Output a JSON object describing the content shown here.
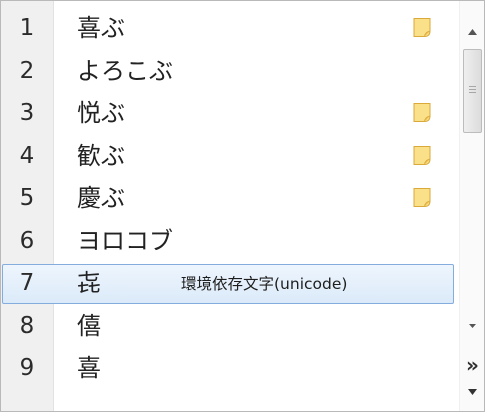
{
  "candidates": [
    {
      "num": "1",
      "word": "喜ぶ",
      "memo": true
    },
    {
      "num": "2",
      "word": "よろこぶ",
      "memo": false
    },
    {
      "num": "3",
      "word": "悦ぶ",
      "memo": true
    },
    {
      "num": "4",
      "word": "歓ぶ",
      "memo": true
    },
    {
      "num": "5",
      "word": "慶ぶ",
      "memo": true
    },
    {
      "num": "6",
      "word": "ヨロコブ",
      "memo": false
    },
    {
      "num": "7",
      "word": "㐂",
      "memo": false,
      "note": "環境依存文字(unicode)",
      "selected": true
    },
    {
      "num": "8",
      "word": "僖",
      "memo": false
    },
    {
      "num": "9",
      "word": "喜",
      "memo": false
    }
  ],
  "scrollbar": {
    "expand_glyph": "»"
  },
  "colors": {
    "selection_fill": "#dbeaf9",
    "selection_border": "#84acdd",
    "memo_icon": "#f7d36a"
  }
}
